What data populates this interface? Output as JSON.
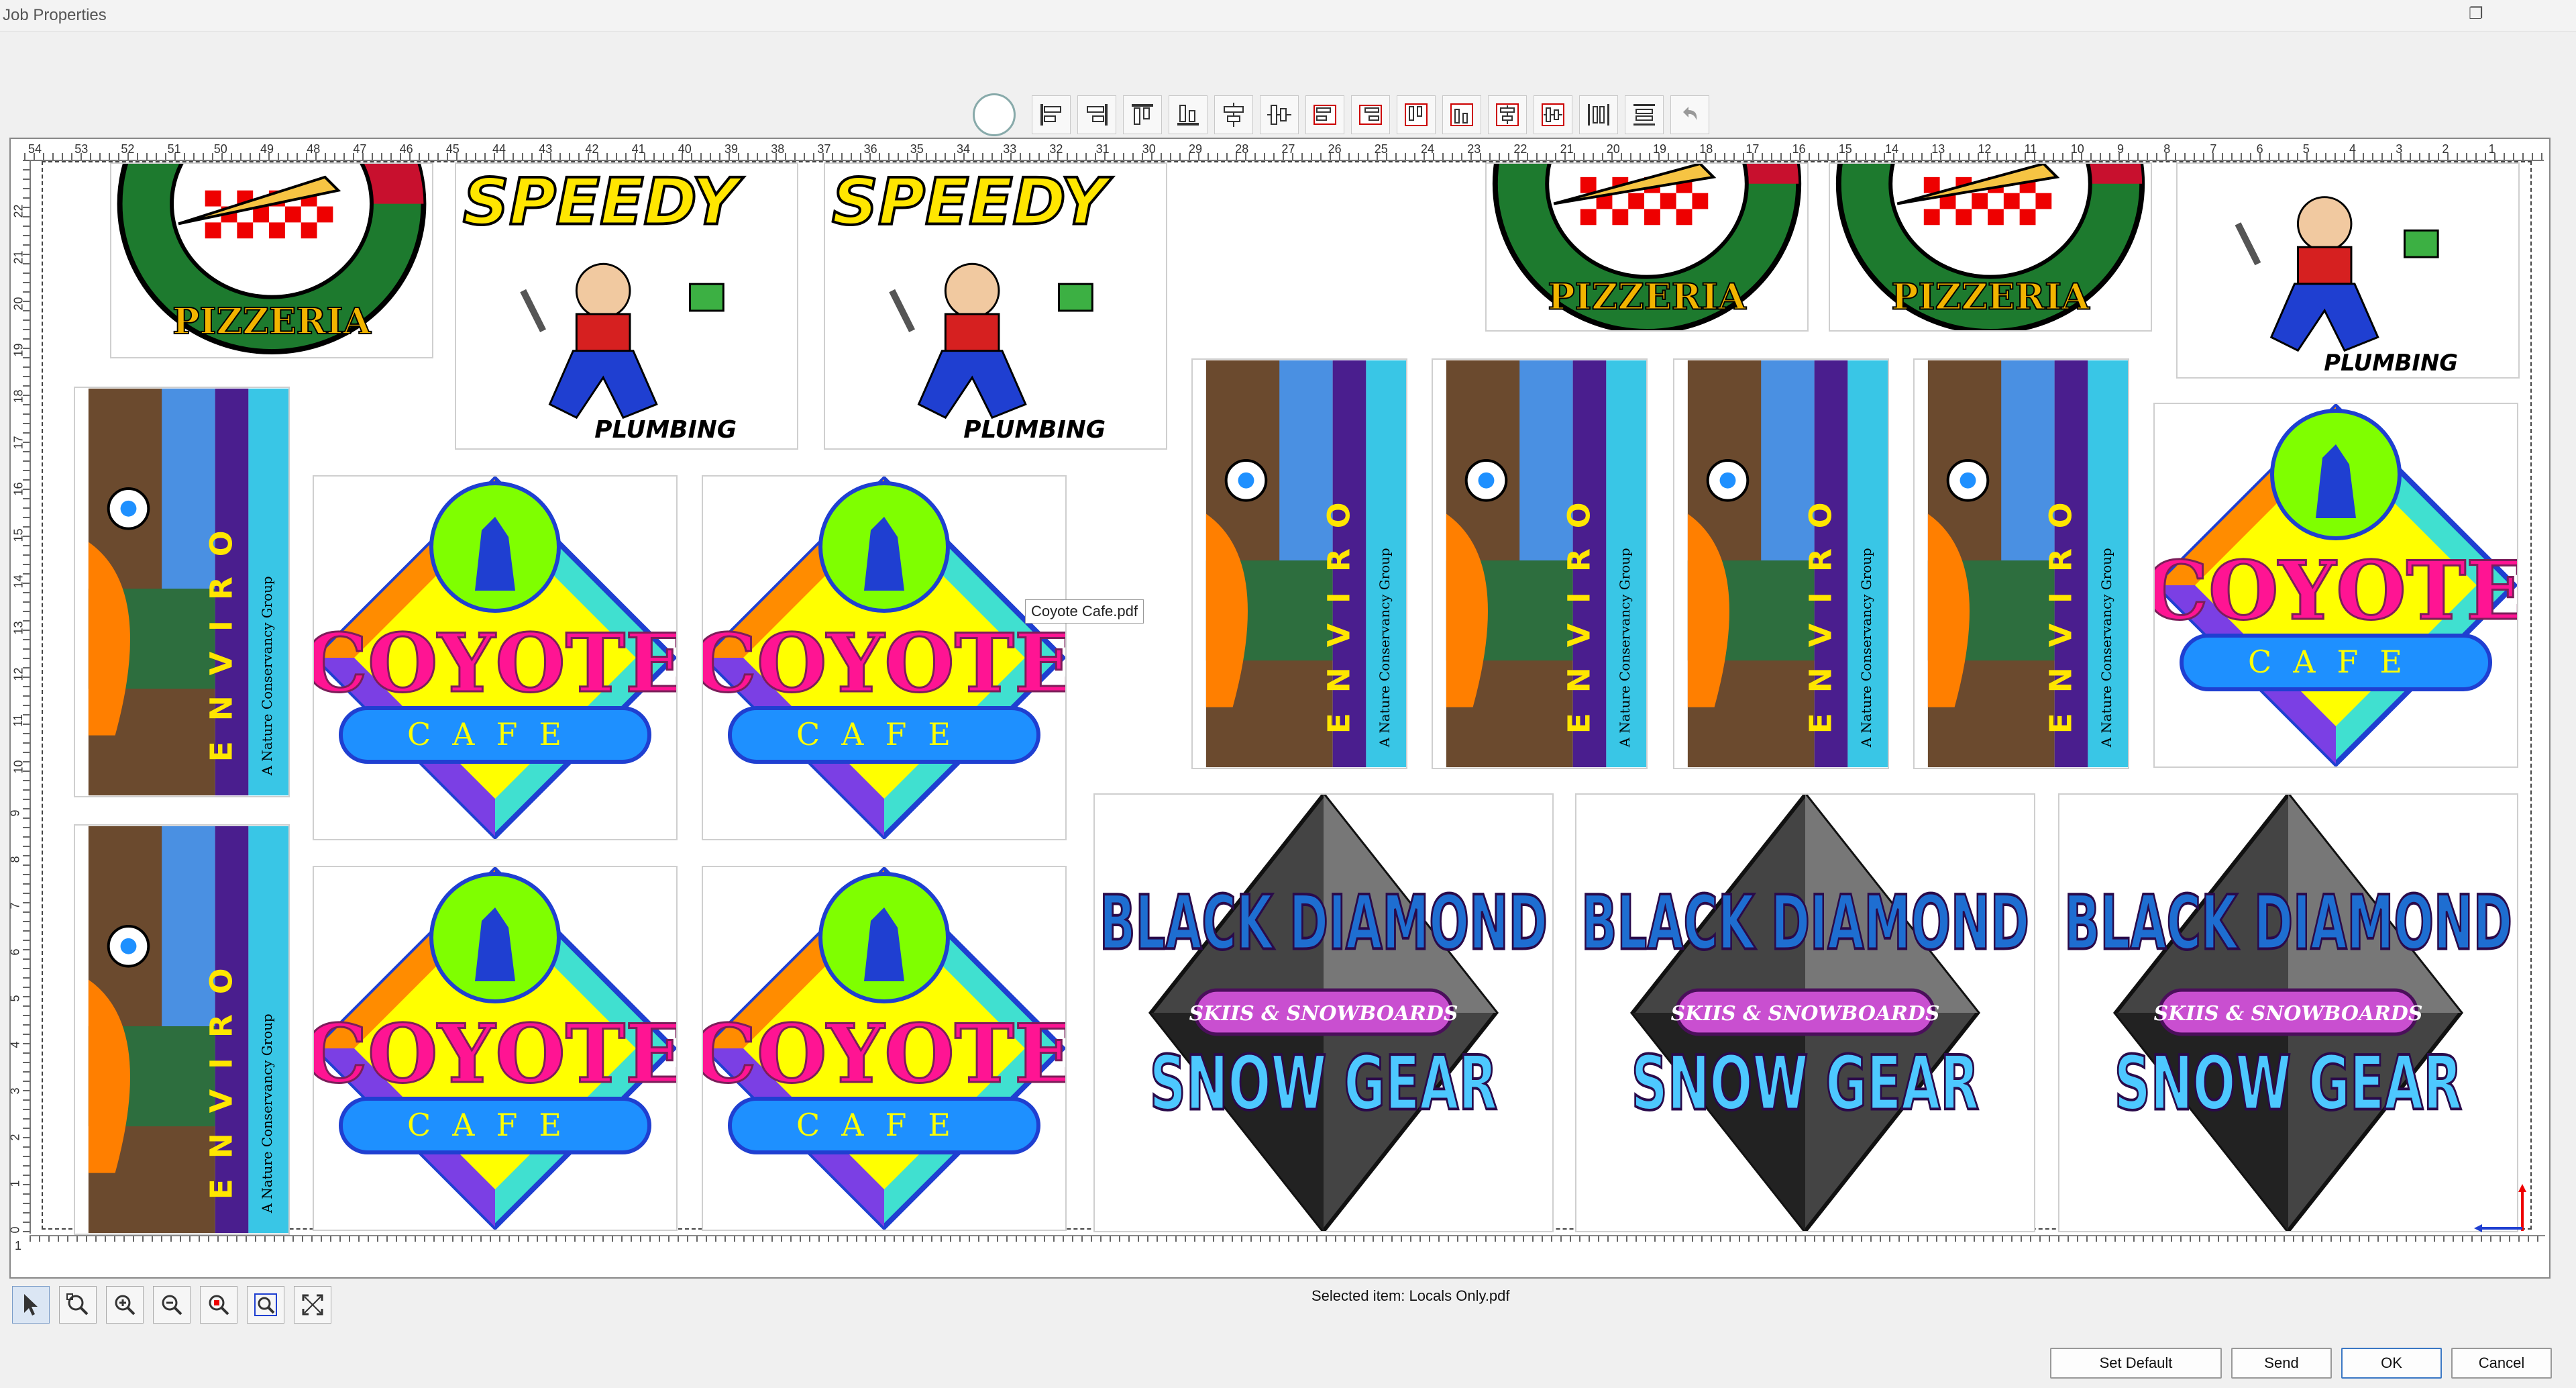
{
  "window": {
    "title": "Job Properties"
  },
  "toolbar": {
    "icons": [
      "clock-icon",
      "align-left-icon",
      "align-right-icon",
      "align-top-icon",
      "align-bottom-icon",
      "center-horizontal-icon",
      "center-vertical-icon",
      "align-left-red-icon",
      "align-right-red-icon",
      "align-top-red-icon",
      "align-bottom-red-icon",
      "center-h-red-icon",
      "center-v-red-icon",
      "distribute-h-icon",
      "distribute-v-icon",
      "undo-icon"
    ]
  },
  "ruler": {
    "horizontal_labels": [
      "54",
      "53",
      "52",
      "51",
      "50",
      "49",
      "48",
      "47",
      "46",
      "45",
      "44",
      "43",
      "42",
      "41",
      "40",
      "39",
      "38",
      "37",
      "36",
      "35",
      "34",
      "33",
      "32",
      "31",
      "30",
      "29",
      "28",
      "27",
      "26",
      "25",
      "24",
      "23",
      "22",
      "21",
      "20",
      "19",
      "18",
      "17",
      "16",
      "15",
      "14",
      "13",
      "12",
      "11",
      "10",
      "9",
      "8",
      "7",
      "6",
      "5",
      "4",
      "3",
      "2",
      "1"
    ],
    "vertical_labels": [
      "22",
      "21",
      "20",
      "19",
      "18",
      "17",
      "16",
      "15",
      "14",
      "13",
      "12",
      "11",
      "10",
      "9",
      "8",
      "7",
      "6",
      "5",
      "4",
      "3",
      "2",
      "1",
      "0"
    ],
    "bottom_marker": "1"
  },
  "layout_items": [
    {
      "file": "Pizzeria",
      "logo": {
        "text": "PIZZERIA"
      }
    },
    {
      "file": "Speedy Plumbing",
      "logo": {
        "top": "SPEEDY",
        "bottom": "PLUMBING"
      }
    },
    {
      "file": "Enviro",
      "logo": {
        "word": "ENVIRO",
        "tag": "A Nature Conservancy Group"
      }
    },
    {
      "file": "Coyote Cafe.pdf",
      "logo": {
        "top": "COYOTE",
        "bottom": "CAFE"
      }
    },
    {
      "file": "Black Diamond",
      "logo": {
        "line1": "BLACK DIAMOND",
        "line2": "SKIIS & SNOWBOARDS",
        "line3": "SNOW GEAR"
      }
    }
  ],
  "tooltip": {
    "text": "Coyote Cafe.pdf"
  },
  "status": {
    "selected": "Selected item: Locals Only.pdf"
  },
  "view_tools": [
    "pointer-icon",
    "zoom-tool-icon",
    "zoom-in-icon",
    "zoom-out-icon",
    "zoom-selection-icon",
    "zoom-fit-icon",
    "fullscreen-icon"
  ],
  "buttons": {
    "set_default": "Set Default",
    "send": "Send",
    "ok": "OK",
    "cancel": "Cancel"
  },
  "colors": {
    "accent": "#3b78c4",
    "coyote_yellow": "#ffff00",
    "coyote_blue": "#1e90ff",
    "pizza_green": "#1d7a2e",
    "pizza_red": "#c8102e",
    "speedy_yellow": "#ffe600"
  }
}
